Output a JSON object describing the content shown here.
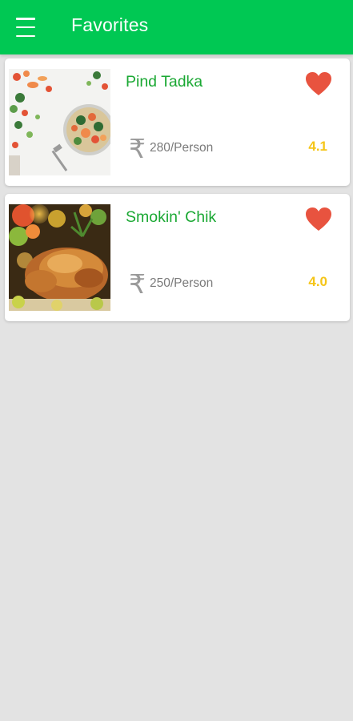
{
  "appbar": {
    "title": "Favorites",
    "menu_icon": "hamburger-menu-icon",
    "color": "#00c853"
  },
  "favorites": [
    {
      "name": "Pind Tadka",
      "currency_icon": "rupee-icon",
      "price": "280/Person",
      "rating": "4.1",
      "favorite_icon": "heart-icon",
      "image": "salad-bowl-photo"
    },
    {
      "name": "Smokin' Chik",
      "currency_icon": "rupee-icon",
      "price": "250/Person",
      "rating": "4.0",
      "favorite_icon": "heart-icon",
      "image": "roast-chicken-photo"
    }
  ],
  "colors": {
    "name": "#1aa833",
    "rating": "#f5c518",
    "heart": "#e8533f",
    "background": "#e3e3e3"
  }
}
